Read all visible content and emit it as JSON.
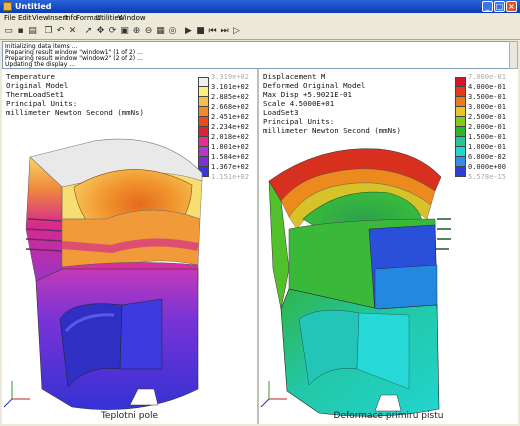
{
  "window": {
    "title": "Untitled"
  },
  "menu": [
    "File",
    "Edit",
    "View",
    "Insert",
    "Info",
    "Format",
    "Utilities",
    "Window"
  ],
  "toolbar_icons": [
    "open-icon",
    "save-icon",
    "print-icon",
    "copy-icon",
    "undo-icon",
    "delete-icon",
    "pointer-icon",
    "orient-icon",
    "spin-icon",
    "refit-icon",
    "zoom-in-icon",
    "zoom-out-icon",
    "view-manager-icon",
    "animate-icon",
    "play-icon",
    "stop-icon",
    "first-frame-icon",
    "last-frame-icon",
    "step-icon"
  ],
  "log": [
    "Initializing data items ...",
    "Preparing result window \"window1\" (1 of 2) ...",
    "Preparing result window \"window2\" (2 of 2) ...",
    "Updating the display ..."
  ],
  "left": {
    "info": [
      "Temperature",
      "Original Model",
      "ThermLoadSet1",
      "Principal Units:",
      "millimeter Newton Second (mmNs)"
    ],
    "legend_labels": [
      "3.319e+02",
      "3.101e+02",
      "2.885e+02",
      "2.668e+02",
      "2.451e+02",
      "2.234e+02",
      "2.018e+02",
      "1.801e+02",
      "1.584e+02",
      "1.367e+02",
      "1.151e+02"
    ],
    "legend_colors": [
      "#f0f0f0",
      "#fbf086",
      "#f5c04a",
      "#f28a2c",
      "#e84b20",
      "#d92435",
      "#e3308e",
      "#b638c6",
      "#7a33d6",
      "#3a36d8"
    ],
    "caption": "Teplotni pole"
  },
  "right": {
    "info": [
      "Displacement M",
      "Deformed Original Model",
      "Max Disp  +5.9021E-01",
      "Scale  4.5000E+01",
      "LoadSet3",
      "Principal Units:",
      "millimeter Newton Second (mmNs)"
    ],
    "legend_labels": [
      "7.000e-01",
      "4.000e-01",
      "3.500e-01",
      "3.000e-01",
      "2.500e-01",
      "2.000e-01",
      "1.500e-01",
      "1.000e-01",
      "6.000e-02",
      "0.000e+00",
      "5.578e-15"
    ],
    "legend_colors": [
      "#d0182a",
      "#e23a1c",
      "#ec7a1e",
      "#e8c52a",
      "#7dcc1f",
      "#2fb52b",
      "#24c793",
      "#22d5d0",
      "#3a8ae8",
      "#2c3ed8"
    ],
    "caption": "Deformace primiru pistu"
  }
}
